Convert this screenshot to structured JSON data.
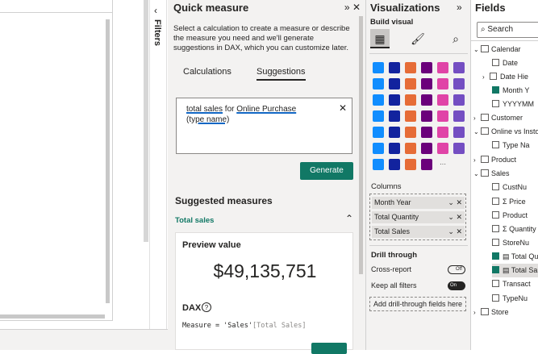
{
  "canvas": {
    "minus_icon": "minus-icon"
  },
  "filters": {
    "label": "Filters",
    "collapse_icon": "chevron-left-icon"
  },
  "quick_measure": {
    "title": "Quick measure",
    "header_icons": [
      "double-chevron-right-icon",
      "close-icon"
    ],
    "description": "Select a calculation to create a measure or describe the measure you need and we'll generate suggestions in DAX, which you can customize later.",
    "tabs": [
      {
        "label": "Calculations",
        "active": false
      },
      {
        "label": "Suggestions",
        "active": true
      }
    ],
    "input_text_1": "total sales",
    "input_text_2": " for ",
    "input_text_3": "Online Purchase",
    "input_text_4": "(type name)",
    "generate_label": "Generate",
    "suggested_title": "Suggested measures",
    "suggestion_name": "Total sales",
    "preview_label": "Preview value",
    "preview_value": "$49,135,751",
    "dax_label": "DAX",
    "dax_expr_1": "Measure = 'Sales'",
    "dax_expr_2": "[Total Sales]"
  },
  "visualizations": {
    "title": "Visualizations",
    "build_visual": "Build visual",
    "build_icons": [
      "table-build-icon",
      "format-brush-icon",
      "analytics-icon"
    ],
    "visual_icons": [
      "stacked-bar-icon",
      "stacked-column-icon",
      "clustered-bar-icon",
      "clustered-column-icon",
      "100-bar-icon",
      "100-column-icon",
      "line-chart-icon",
      "area-chart-icon",
      "stacked-area-icon",
      "line-column-icon",
      "line-clustered-icon",
      "ribbon-chart-icon",
      "waterfall-icon",
      "funnel-icon",
      "scatter-icon",
      "pie-icon",
      "donut-icon",
      "treemap-icon",
      "map-icon",
      "filled-map-icon",
      "shape-map-icon",
      "azure-map-icon",
      "gauge-icon",
      "card-icon",
      "multirow-card-icon",
      "kpi-icon",
      "slicer-icon",
      "table-icon",
      "matrix-icon",
      "r-visual-icon",
      "python-visual-icon",
      "key-influencers-icon",
      "decomposition-tree-icon",
      "qa-icon",
      "smart-narrative-icon",
      "goals-icon",
      "paginated-report-icon",
      "power-apps-icon",
      "power-automate-icon",
      "diamond-icon",
      "more-icon"
    ],
    "columns_label": "Columns",
    "columns": [
      "Month Year",
      "Total Quantity",
      "Total Sales"
    ],
    "drill_through": "Drill through",
    "cross_report": "Cross-report",
    "cross_report_state": "Off",
    "keep_filters": "Keep all filters",
    "keep_filters_state": "On",
    "add_drill": "Add drill-through fields here"
  },
  "fields": {
    "title": "Fields",
    "search_placeholder": "Search",
    "items": [
      {
        "label": "Calendar",
        "kind": "table"
      },
      {
        "label": "Date",
        "kind": "field"
      },
      {
        "label": "Date Hie",
        "kind": "hierarchy"
      },
      {
        "label": "Month Y",
        "kind": "field"
      },
      {
        "label": "YYYYMM",
        "kind": "field"
      },
      {
        "label": "Customer",
        "kind": "table"
      },
      {
        "label": "Online vs Insto",
        "kind": "table"
      },
      {
        "label": "Type Na",
        "kind": "field"
      },
      {
        "label": "Product",
        "kind": "table"
      },
      {
        "label": "Sales",
        "kind": "table"
      },
      {
        "label": "CustNu",
        "kind": "field"
      },
      {
        "label": "Price",
        "kind": "field"
      },
      {
        "label": "Product",
        "kind": "field"
      },
      {
        "label": "Quantity",
        "kind": "field"
      },
      {
        "label": "StoreNu",
        "kind": "field"
      },
      {
        "label": "Total Qu",
        "kind": "measure"
      },
      {
        "label": "Total Sa",
        "kind": "measure"
      },
      {
        "label": "Transact",
        "kind": "field"
      },
      {
        "label": "TypeNu",
        "kind": "field"
      },
      {
        "label": "Store",
        "kind": "table"
      }
    ]
  }
}
